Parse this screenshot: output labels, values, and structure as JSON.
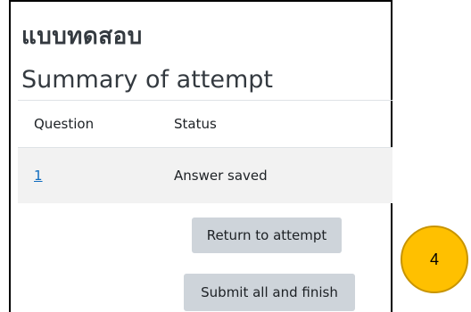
{
  "quiz": {
    "name": "แบบทดสอบ",
    "summary_title": "Summary of attempt"
  },
  "table": {
    "headers": {
      "question": "Question",
      "status": "Status"
    },
    "rows": [
      {
        "question": "1",
        "status": "Answer saved"
      }
    ]
  },
  "buttons": {
    "return": "Return to attempt",
    "submit": "Submit all and finish"
  },
  "annotation": {
    "step": "4",
    "color": "#ffc000"
  }
}
